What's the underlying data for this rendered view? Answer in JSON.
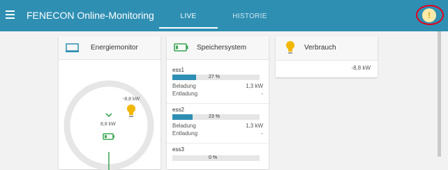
{
  "header": {
    "title": "FENECON Online-Monitoring",
    "tabs": [
      {
        "label": "LIVE"
      },
      {
        "label": "HISTORIE"
      }
    ],
    "alert_symbol": "!"
  },
  "energiemonitor": {
    "title": "Energiemonitor",
    "consumption_value": "-8,8 kW",
    "grid_value": "8,8 kW"
  },
  "speichersystem": {
    "title": "Speichersystem",
    "systems": [
      {
        "name": "ess1",
        "soc_label": "27 %",
        "soc": 0.27,
        "beladung_label": "Beladung",
        "beladung_value": "1,3 kW",
        "entladung_label": "Entladung",
        "entladung_value": "-"
      },
      {
        "name": "ess2",
        "soc_label": "23 %",
        "soc": 0.23,
        "beladung_label": "Beladung",
        "beladung_value": "1,3 kW",
        "entladung_label": "Entladung",
        "entladung_value": "-"
      },
      {
        "name": "ess3",
        "soc_label": "0 %",
        "soc": 0.0
      }
    ]
  },
  "verbrauch": {
    "title": "Verbrauch",
    "value": "-8,8 kW"
  },
  "colors": {
    "primary": "#2e8fb3",
    "battery_green": "#3aa655",
    "bulb_yellow": "#f2b705",
    "alert_ring": "#e2001a"
  }
}
